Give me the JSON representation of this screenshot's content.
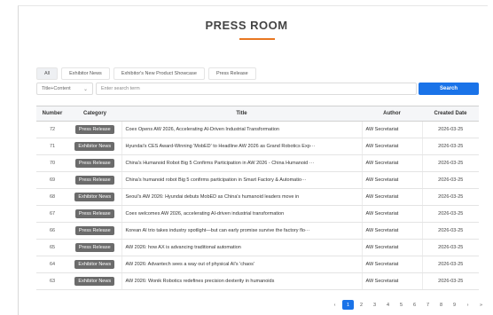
{
  "page": {
    "title": "PRESS ROOM",
    "accent": "#e87722",
    "primary": "#1a73e8"
  },
  "tabs": [
    {
      "label": "All",
      "active": true
    },
    {
      "label": "Exhibitor News",
      "active": false
    },
    {
      "label": "Exhibitor's New Product Showcase",
      "active": false
    },
    {
      "label": "Press Release",
      "active": false
    }
  ],
  "filter": {
    "select_value": "Title+Content",
    "search_placeholder": "Enter search term",
    "search_button": "Search"
  },
  "table": {
    "headers": [
      "Number",
      "Category",
      "Title",
      "Author",
      "Created Date"
    ],
    "rows": [
      {
        "number": "72",
        "category": "Press Release",
        "title": "Coex Opens AW 2026, Accelerating AI-Driven Industrial Transformation",
        "author": "AW Secretariat",
        "date": "2026-03-25"
      },
      {
        "number": "71",
        "category": "Exhibitor News",
        "title": "Hyundai's CES Award-Winning 'MobED' to Headline AW 2026 as Grand Robotics Exp···",
        "author": "AW Secretariat",
        "date": "2026-03-25"
      },
      {
        "number": "70",
        "category": "Press Release",
        "title": "China's Humanoid Robot Big 5 Confirms Participation in AW 2026 - China Humanoid ···",
        "author": "AW Secretariat",
        "date": "2026-03-25"
      },
      {
        "number": "69",
        "category": "Press Release",
        "title": "China's humanoid robot Big 5 confirms participation in Smart Factory & Automatio···",
        "author": "AW Secretariat",
        "date": "2026-03-25"
      },
      {
        "number": "68",
        "category": "Exhibitor News",
        "title": "Seoul's AW 2026: Hyundai debuts MobED as China's humanoid leaders move in",
        "author": "AW Secretariat",
        "date": "2026-03-25"
      },
      {
        "number": "67",
        "category": "Press Release",
        "title": "Coex welcomes AW 2026, accelerating AI-driven industrial transformation",
        "author": "AW Secretariat",
        "date": "2026-03-25"
      },
      {
        "number": "66",
        "category": "Press Release",
        "title": "Korean AI trio takes industry spotlight—but can early promise survive the factory flo···",
        "author": "AW Secretariat",
        "date": "2026-03-25"
      },
      {
        "number": "65",
        "category": "Press Release",
        "title": "AW 2026: how AX is advancing traditional automation",
        "author": "AW Secretariat",
        "date": "2026-03-25"
      },
      {
        "number": "64",
        "category": "Exhibitor News",
        "title": "AW 2026: Advantech sees a way out of physical AI's 'chaos'",
        "author": "AW Secretariat",
        "date": "2026-03-25"
      },
      {
        "number": "63",
        "category": "Exhibitor News",
        "title": "AW 2026: Wonik Robotics redefines precision dexterity in humanoids",
        "author": "AW Secretariat",
        "date": "2026-03-25"
      }
    ]
  },
  "pagination": {
    "prev": "‹",
    "pages": [
      "1",
      "2",
      "3",
      "4",
      "5",
      "6",
      "7",
      "8",
      "9"
    ],
    "current": "1",
    "next": "›",
    "last": "»"
  }
}
